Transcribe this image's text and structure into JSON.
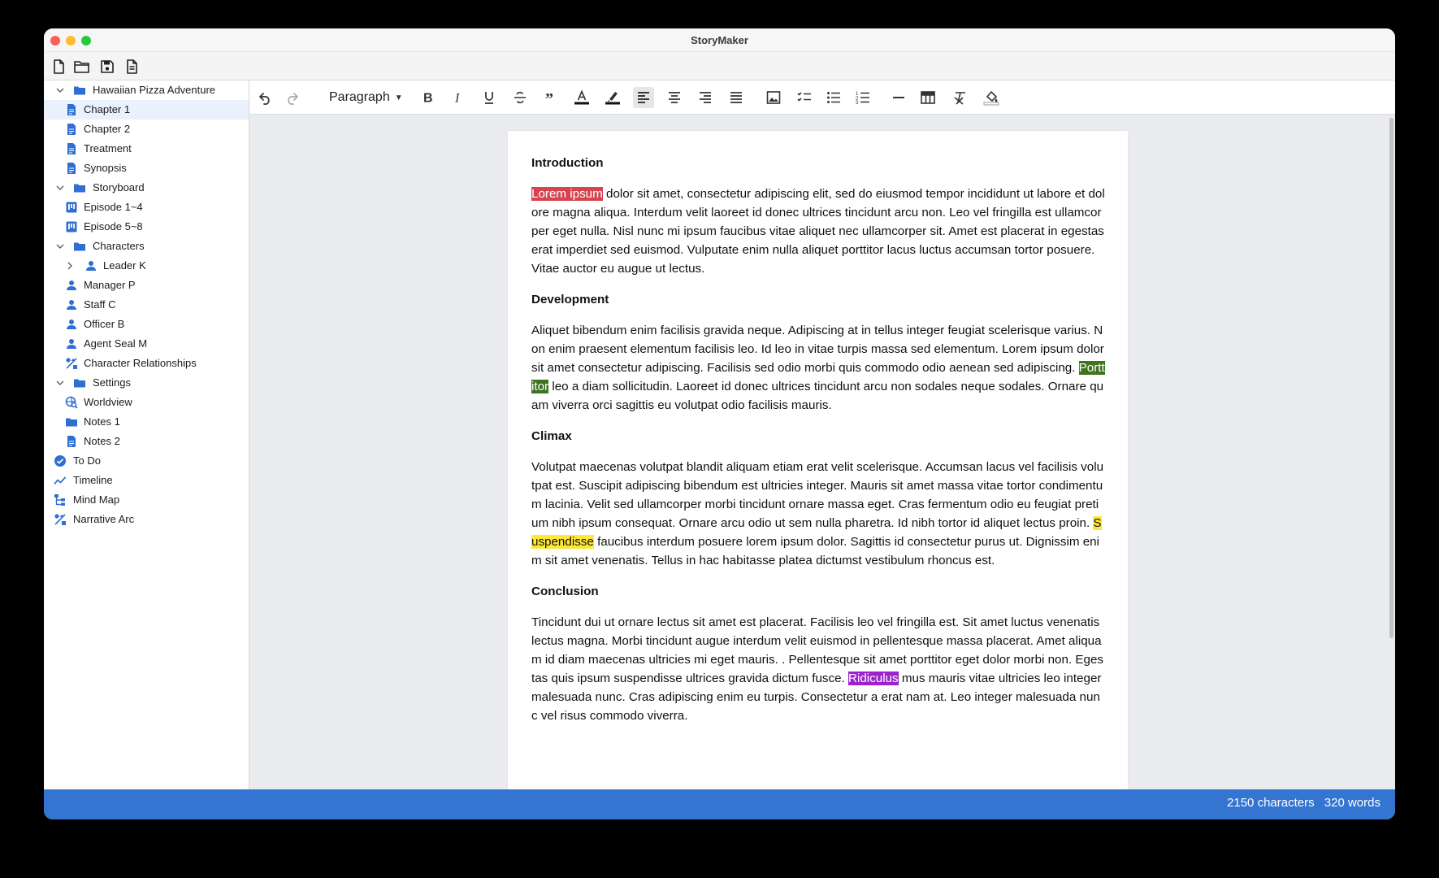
{
  "app": {
    "title": "StoryMaker"
  },
  "file_toolbar": [
    "new-file-icon",
    "open-folder-icon",
    "save-icon",
    "export-document-icon"
  ],
  "sidebar": {
    "items": [
      {
        "label": "Hawaiian Pizza Adventure",
        "icon": "folder-icon",
        "level": 0,
        "expanded": true
      },
      {
        "label": "Chapter 1",
        "icon": "document-icon",
        "level": 1,
        "selected": true
      },
      {
        "label": "Chapter 2",
        "icon": "document-icon",
        "level": 1
      },
      {
        "label": "Treatment",
        "icon": "document-icon",
        "level": 1
      },
      {
        "label": "Synopsis",
        "icon": "document-icon",
        "level": 1
      },
      {
        "label": "Storyboard",
        "icon": "folder-icon",
        "level": 0,
        "expanded": true
      },
      {
        "label": "Episode 1~4",
        "icon": "storyboard-icon",
        "level": 1
      },
      {
        "label": "Episode 5~8",
        "icon": "storyboard-icon",
        "level": 1
      },
      {
        "label": "Characters",
        "icon": "folder-icon",
        "level": 0,
        "expanded": true
      },
      {
        "label": "Leader K",
        "icon": "person-icon",
        "level": 1,
        "collapsed": true
      },
      {
        "label": "Manager P",
        "icon": "person-icon",
        "level": 1
      },
      {
        "label": "Staff C",
        "icon": "person-icon",
        "level": 1
      },
      {
        "label": "Officer B",
        "icon": "person-icon",
        "level": 1
      },
      {
        "label": "Agent Seal M",
        "icon": "person-icon",
        "level": 1
      },
      {
        "label": "Character Relationships",
        "icon": "relationship-icon",
        "level": 1
      },
      {
        "label": "Settings",
        "icon": "folder-icon",
        "level": 0,
        "expanded": true
      },
      {
        "label": "Worldview",
        "icon": "globe-search-icon",
        "level": 1
      },
      {
        "label": "Notes 1",
        "icon": "folder-icon",
        "level": 1
      },
      {
        "label": "Notes 2",
        "icon": "document-icon",
        "level": 1
      },
      {
        "label": "To Do",
        "icon": "check-circle-icon",
        "level": -1
      },
      {
        "label": "Timeline",
        "icon": "timeline-icon",
        "level": -1
      },
      {
        "label": "Mind Map",
        "icon": "mind-map-icon",
        "level": -1
      },
      {
        "label": "Narrative Arc",
        "icon": "relationship-icon",
        "level": -1
      }
    ]
  },
  "toolbar": {
    "block_format": "Paragraph",
    "buttons": [
      "undo",
      "redo",
      "bold",
      "italic",
      "underline",
      "strikethrough",
      "blockquote",
      "text-color",
      "highlight",
      "align-left",
      "align-center",
      "align-right",
      "align-justify",
      "image",
      "checklist",
      "bullet-list",
      "numbered-list",
      "horizontal-rule",
      "table",
      "clear-formatting",
      "fill-color"
    ],
    "active": "align-left"
  },
  "document": {
    "sections": [
      {
        "heading": "Introduction",
        "highlight": "Lorem ipsum",
        "before": "",
        "after": " dolor sit amet, consectetur adipiscing elit, sed do eiusmod tempor incididunt ut labore et dolore magna aliqua. Interdum velit laoreet id donec ultrices tincidunt arcu non. Leo vel fringilla est ullamcorper eget nulla. Nisl nunc mi ipsum faucibus vitae aliquet nec ullamcorper sit. Amet est placerat in egestas erat imperdiet sed euismod. Vulputate enim nulla aliquet porttitor lacus luctus accumsan tortor posuere. Vitae auctor eu augue ut lectus."
      },
      {
        "heading": "Development",
        "before": "Aliquet bibendum enim facilisis gravida neque. Adipiscing at in tellus integer feugiat scelerisque varius. Non enim praesent elementum facilisis leo. Id leo in vitae turpis massa sed elementum. Lorem ipsum dolor sit amet consectetur adipiscing. Facilisis sed odio morbi quis commodo odio aenean sed adipiscing. ",
        "highlight": "Porttitor",
        "after": " leo a diam sollicitudin. Laoreet id donec ultrices tincidunt arcu non sodales neque sodales. Ornare quam viverra orci sagittis eu volutpat odio facilisis mauris."
      },
      {
        "heading": "Climax",
        "before": "Volutpat maecenas volutpat blandit aliquam etiam erat velit scelerisque. Accumsan lacus vel facilisis volutpat est. Suscipit adipiscing bibendum est ultricies integer. Mauris sit amet massa vitae tortor condimentum lacinia. Velit sed ullamcorper morbi tincidunt ornare massa eget. Cras fermentum odio eu feugiat pretium nibh ipsum consequat. Ornare arcu odio ut sem nulla pharetra. Id nibh tortor id aliquet lectus proin. ",
        "highlight": "Suspendisse",
        "after": " faucibus interdum posuere lorem ipsum dolor. Sagittis id consectetur purus ut. Dignissim enim sit amet venenatis. Tellus in hac habitasse platea dictumst vestibulum rhoncus est."
      },
      {
        "heading": "Conclusion",
        "before": "Tincidunt dui ut ornare lectus sit amet est placerat. Facilisis leo vel fringilla est. Sit amet luctus venenatis lectus magna. Morbi tincidunt augue interdum velit euismod in pellentesque massa placerat. Amet aliquam id diam maecenas ultricies mi eget mauris. . Pellentesque sit amet porttitor eget dolor morbi non. Egestas quis ipsum suspendisse ultrices gravida dictum fusce. ",
        "highlight": "Ridiculus",
        "after": " mus mauris vitae ultricies leo integer malesuada nunc. Cras adipiscing enim eu turpis. Consectetur a erat nam at. Leo integer malesuada nunc vel risus commodo viverra."
      }
    ]
  },
  "status": {
    "characters": "2150 characters",
    "words": "320 words"
  },
  "colors": {
    "accent": "#3375d0",
    "icon_blue": "#2f6fd1",
    "highlight_red": "#d6454f",
    "highlight_green": "#3e7320",
    "highlight_yellow": "#fde837",
    "highlight_purple": "#9b22cc"
  }
}
